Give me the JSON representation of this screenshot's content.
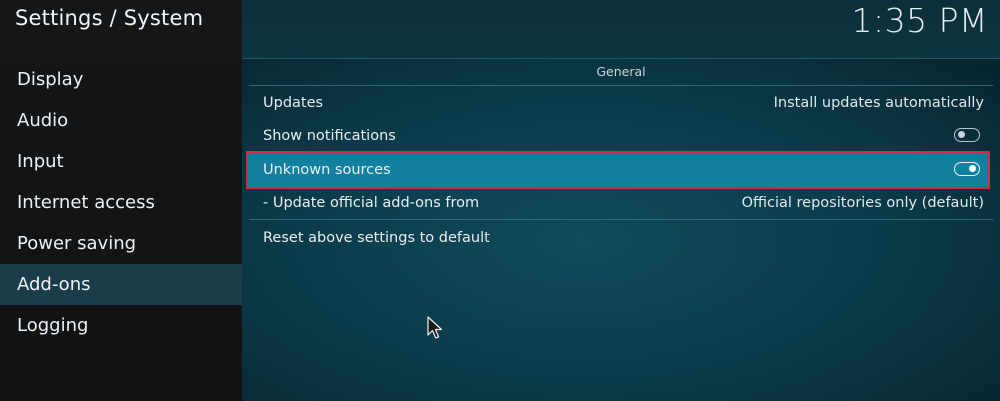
{
  "header": {
    "title": "Settings / System",
    "clock": "1:35 PM"
  },
  "sidebar": {
    "items": [
      {
        "label": "Display"
      },
      {
        "label": "Audio"
      },
      {
        "label": "Input"
      },
      {
        "label": "Internet access"
      },
      {
        "label": "Power saving"
      },
      {
        "label": "Add-ons",
        "active": true
      },
      {
        "label": "Logging"
      }
    ]
  },
  "main": {
    "section_title": "General",
    "settings": {
      "updates": {
        "label": "Updates",
        "value": "Install updates automatically"
      },
      "show_notifications": {
        "label": "Show notifications",
        "state": "off"
      },
      "unknown_sources": {
        "label": "Unknown sources",
        "state": "on",
        "focused": true
      },
      "update_official": {
        "label": "- Update official add-ons from",
        "value": "Official repositories only (default)"
      },
      "reset": {
        "label": "Reset above settings to default"
      }
    }
  },
  "colors": {
    "accent_focus": "#11809f",
    "focus_outline": "#d62a3c",
    "sidebar_active": "#1b3c4a"
  }
}
